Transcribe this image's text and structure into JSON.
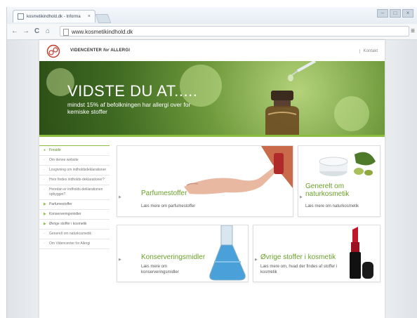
{
  "browser": {
    "tab_title": "kosmetikindhold.dk - Informa",
    "tab_close": "×",
    "url": "www.kosmetikindhold.dk",
    "back": "←",
    "forward": "→",
    "reload": "C",
    "home": "⌂",
    "menu": "≡",
    "win_min": "–",
    "win_max": "□",
    "win_close": "×"
  },
  "site": {
    "brand_prefix": "VIDENCENTER ",
    "brand_italic": "for",
    "brand_suffix": " ALLERGI",
    "contact": "Kontakt",
    "hero_title": "VIDSTE DU AT.....",
    "hero_subtitle": "mindst 15% af befolkningen har allergi over for kemiske stoffer",
    "accent_color": "#8cbd3f",
    "sidebar": [
      {
        "label": "Forside",
        "active": true
      },
      {
        "label": "Om denne website"
      },
      {
        "label": "Lovgivning om indholdsdeklarationer"
      },
      {
        "label": "Hvor findes indholds-deklarationer?"
      },
      {
        "label": "Hvordan er indholds-deklarationen opbygget?"
      },
      {
        "label": "Parfumestoffer"
      },
      {
        "label": "Konserveringsmidler"
      },
      {
        "label": "Øvrige stoffer i kosmetik"
      },
      {
        "label": "Generelt om naturkosmetik"
      },
      {
        "label": "Om Videncenter for Allergi"
      }
    ],
    "cards": [
      {
        "title": "Parfumestoffer",
        "link": "Læs mere om parfumestoffer"
      },
      {
        "title": "Generelt om naturkosmetik",
        "link": "Læs mere om naturkosmetik"
      },
      {
        "title": "Konserveringsmidler",
        "link": "Læs mere om konserveringsmidler"
      },
      {
        "title": "Øvrige stoffer i kosmetik",
        "link": "Læs mere om, hvad der findes af stoffer i kosmetik"
      }
    ]
  }
}
